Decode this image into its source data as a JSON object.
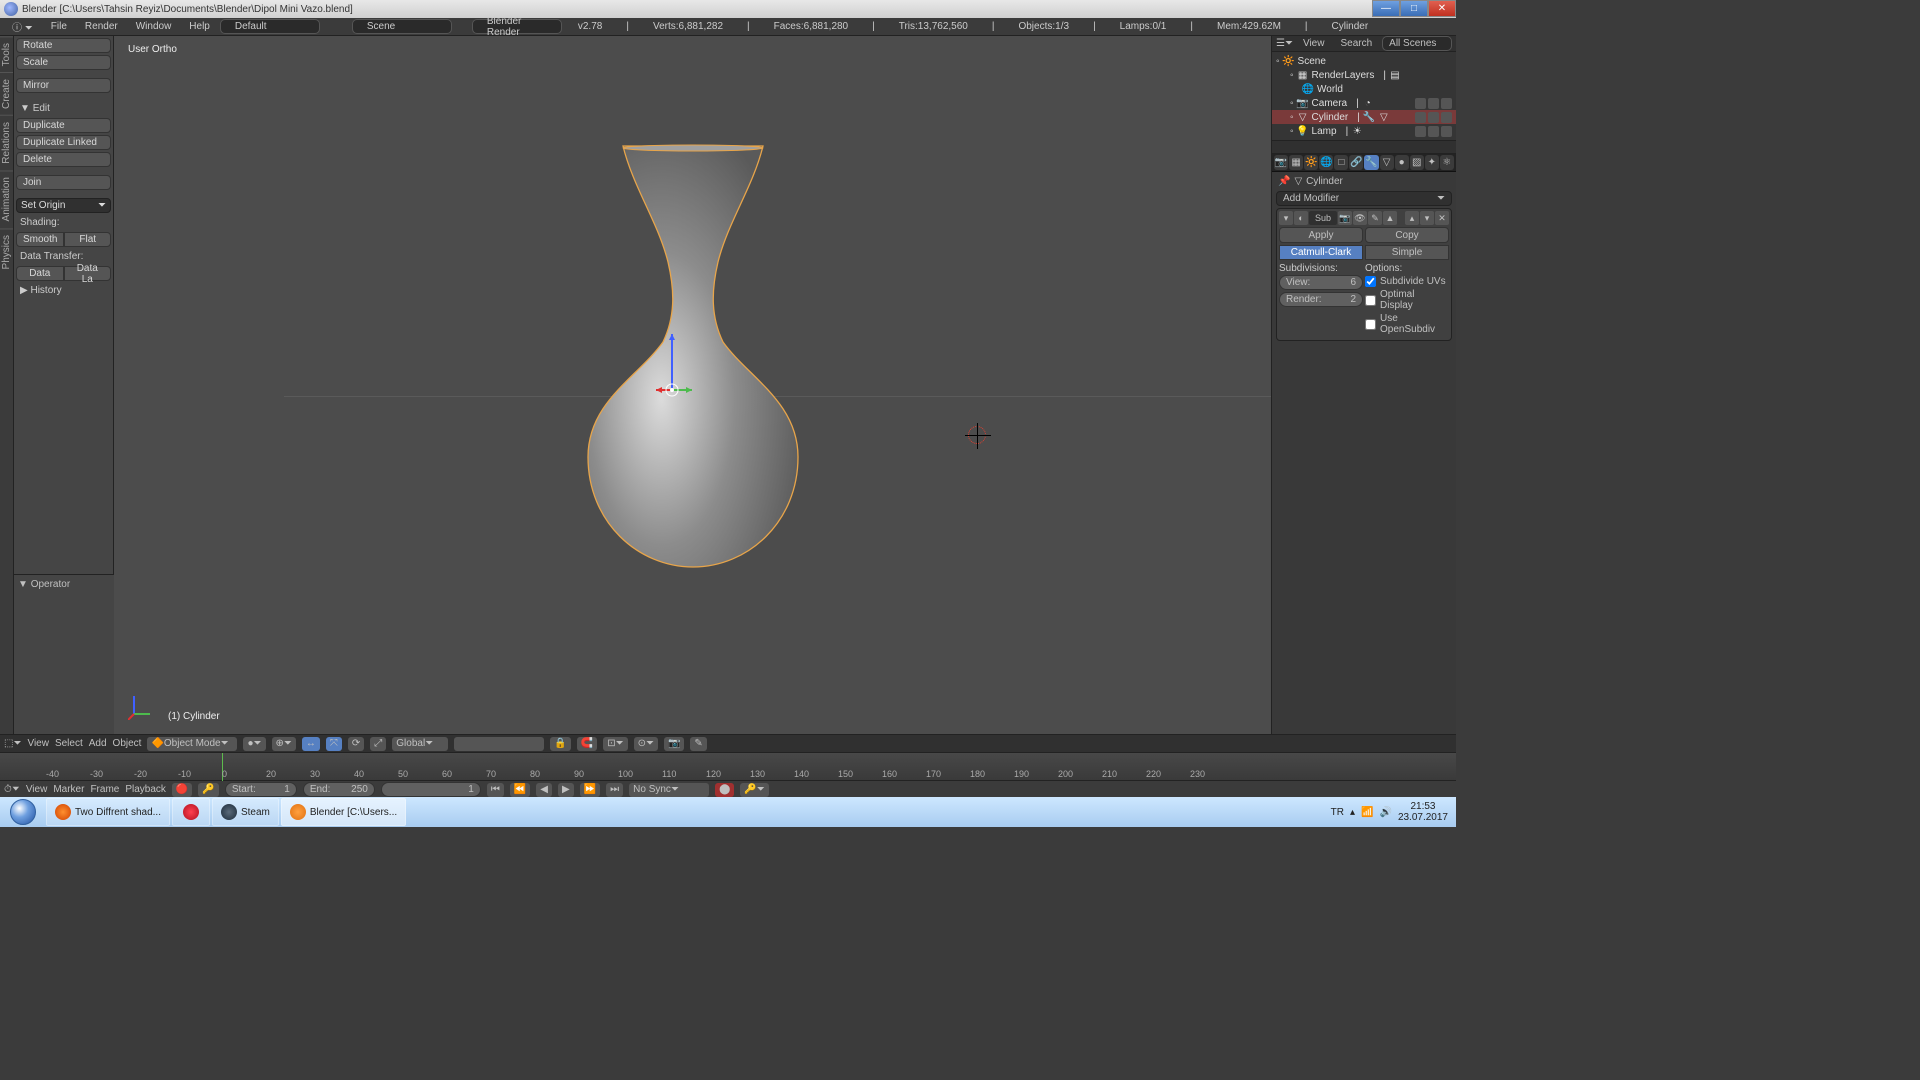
{
  "titlebar": {
    "app": "Blender",
    "file": "[C:\\Users\\Tahsin Reyiz\\Documents\\Blender\\Dipol Mini Vazo.blend]"
  },
  "menu": {
    "file": "File",
    "render": "Render",
    "window": "Window",
    "help": "Help",
    "layout": "Default",
    "scene": "Scene",
    "engine": "Blender Render"
  },
  "stats": {
    "version": "v2.78",
    "verts": "Verts:6,881,282",
    "faces": "Faces:6,881,280",
    "tris": "Tris:13,762,560",
    "objects": "Objects:1/3",
    "lamps": "Lamps:0/1",
    "mem": "Mem:429.62M",
    "active": "Cylinder"
  },
  "tool": {
    "rotate": "Rotate",
    "scale": "Scale",
    "mirror": "Mirror",
    "edit": "Edit",
    "duplicate": "Duplicate",
    "dup_linked": "Duplicate Linked",
    "delete": "Delete",
    "join": "Join",
    "set_origin": "Set Origin",
    "shading": "Shading:",
    "smooth": "Smooth",
    "flat": "Flat",
    "data_transfer": "Data Transfer:",
    "data": "Data",
    "data_la": "Data La",
    "history": "History",
    "operator": "Operator"
  },
  "viewport": {
    "label": "User Ortho",
    "obj": "(1) Cylinder"
  },
  "vp_header": {
    "view": "View",
    "select": "Select",
    "add": "Add",
    "object": "Object",
    "mode": "Object Mode",
    "orient": "Global"
  },
  "outliner": {
    "view": "View",
    "search": "Search",
    "all_scenes": "All Scenes",
    "scene": "Scene",
    "renderlayers": "RenderLayers",
    "world": "World",
    "camera": "Camera",
    "cylinder": "Cylinder",
    "lamp": "Lamp"
  },
  "props": {
    "bc_obj": "Cylinder",
    "add_modifier": "Add Modifier",
    "mod_name": "Sub",
    "apply": "Apply",
    "copy": "Copy",
    "catmull": "Catmull-Clark",
    "simple": "Simple",
    "subdiv_label": "Subdivisions:",
    "options_label": "Options:",
    "view": "View:",
    "view_val": "6",
    "render": "Render:",
    "render_val": "2",
    "sub_uv": "Subdivide UVs",
    "opt_disp": "Optimal Display",
    "opensub": "Use OpenSubdiv"
  },
  "timeline": {
    "view": "View",
    "marker": "Marker",
    "frame": "Frame",
    "playback": "Playback",
    "start": "Start:",
    "start_val": "1",
    "end": "End:",
    "end_val": "250",
    "cur": "1",
    "sync": "No Sync"
  },
  "ticks": [
    "-40",
    "-30",
    "-20",
    "-10",
    "0",
    "20",
    "30",
    "40",
    "50",
    "60",
    "70",
    "80",
    "90",
    "100",
    "110",
    "120",
    "130",
    "140",
    "150",
    "160",
    "170",
    "180",
    "190",
    "200",
    "210",
    "220",
    "230"
  ],
  "taskbar": {
    "firefox": "Two Diffrent shad...",
    "steam": "Steam",
    "blender": "Blender [C:\\Users...",
    "lang": "TR",
    "time": "21:53",
    "date": "23.07.2017"
  },
  "vtabs": [
    "Tools",
    "Create",
    "Relations",
    "Animation",
    "Physics"
  ]
}
